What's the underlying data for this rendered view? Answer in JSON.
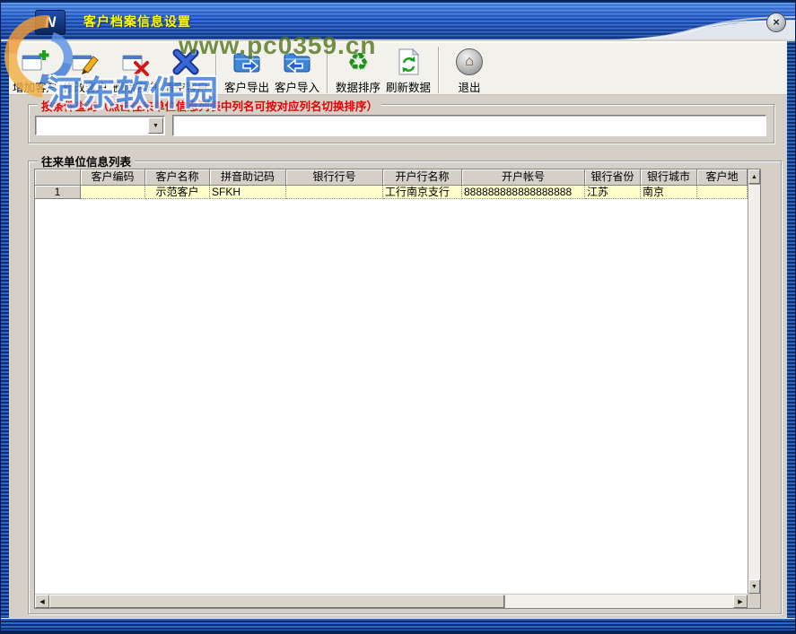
{
  "window": {
    "title": "客户档案信息设置",
    "app_icon_glyph": "N"
  },
  "icons": {
    "close": "×",
    "combo_arrow": "▼",
    "scroll_up": "▲",
    "scroll_down": "▼",
    "scroll_left": "◀",
    "scroll_right": "▶",
    "recycle": "♻",
    "home": "⌂"
  },
  "toolbar": {
    "buttons": [
      {
        "label": "增加客户"
      },
      {
        "label": "修改客户"
      },
      {
        "label": "删除客户"
      },
      {
        "label": "清空客户"
      },
      {
        "label": "客户导出"
      },
      {
        "label": "客户导入"
      },
      {
        "label": "数据排序"
      },
      {
        "label": "刷新数据"
      },
      {
        "label": "退出"
      }
    ]
  },
  "query_box": {
    "title": "按条件查询（点击往来单位信息列表中列名可按对应列名切换排序）",
    "field_select_value": "",
    "keyword_value": ""
  },
  "list_box": {
    "title": "往来单位信息列表",
    "columns": [
      "",
      "客户编码",
      "客户名称",
      "拼音助记码",
      "银行行号",
      "开户行名称",
      "开户帐号",
      "银行省份",
      "银行城市",
      "客户地"
    ],
    "rows": [
      {
        "row_no": "1",
        "cells": [
          "",
          "示范客户",
          "SFKH",
          "",
          "工行南京支行",
          "888888888888888888",
          "江苏",
          "南京",
          ""
        ]
      }
    ]
  },
  "watermarks": {
    "site_logo_text": "河东软件园",
    "site_url": "www.pc0359.cn"
  },
  "colors": {
    "titlebar_blue": "#1b54c4",
    "title_text": "#ffff00",
    "group_title_red": "#e60000",
    "row_highlight": "#ffffcc",
    "client_gray": "#d4d0c8",
    "toolbar_bg": "#f2f1ec"
  }
}
